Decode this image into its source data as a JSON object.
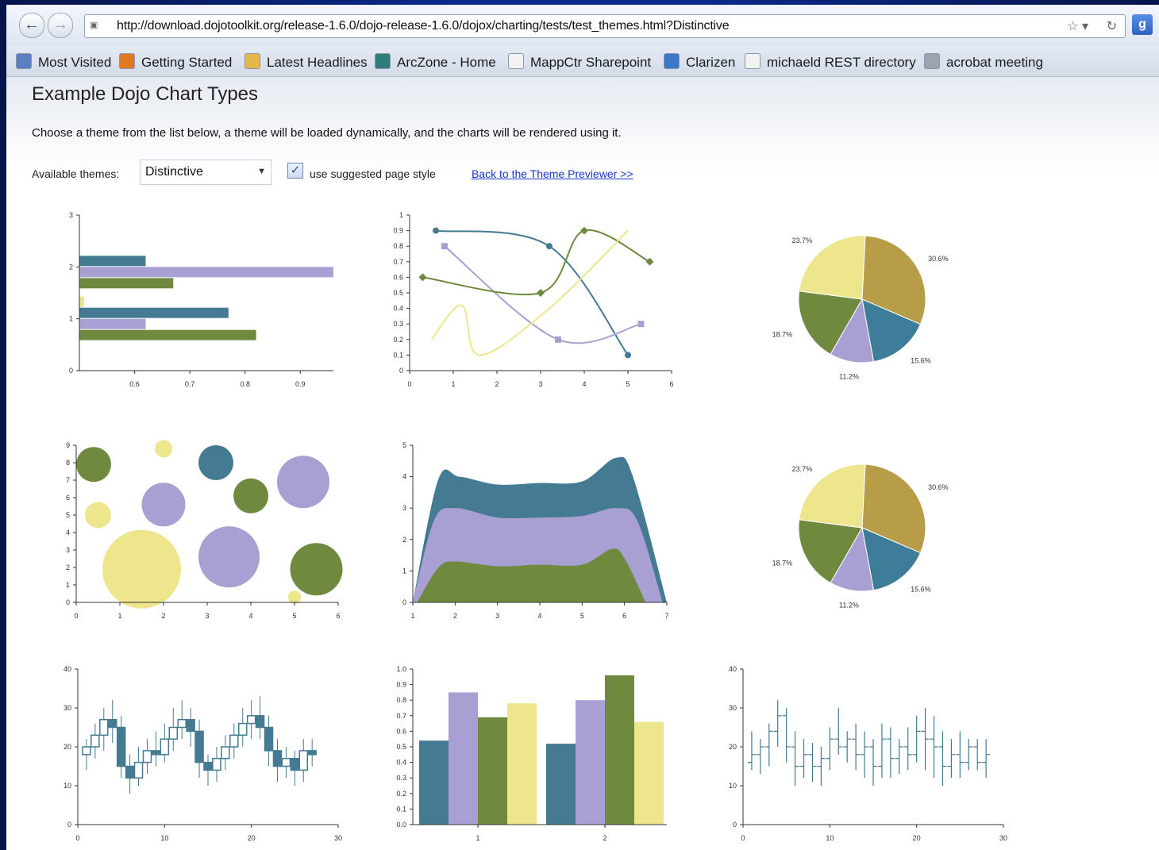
{
  "browser": {
    "url": "http://download.dojotoolkit.org/release-1.6.0/dojo-release-1.6.0/dojox/charting/tests/test_themes.html?Distinctive",
    "bookmarks": [
      "Most Visited",
      "Getting Started",
      "Latest Headlines",
      "ArcZone - Home",
      "MappCtr Sharepoint",
      "Clarizen",
      "michaeld REST directory",
      "acrobat meeting"
    ]
  },
  "page": {
    "title": "Example Dojo Chart Types",
    "intro": "Choose a theme from the list below, a theme will be loaded dynamically, and the charts will be rendered using it.",
    "themes_label": "Available themes:",
    "selected_theme": "Distinctive",
    "checkbox_label": "use suggested page style",
    "link_text": "Back to the Theme Previewer >>"
  },
  "colors": {
    "teal": "#447b93",
    "lavender": "#a8a0d3",
    "olive": "#6f8a3f",
    "yellow": "#ede68d",
    "gold": "#b89d48",
    "blue": "#3d7d99"
  },
  "chart_data": [
    {
      "id": "bars",
      "type": "bar",
      "orientation": "horizontal",
      "categories": [
        "1",
        "2"
      ],
      "series": [
        {
          "values": [
            0.82,
            0.67
          ]
        },
        {
          "values": [
            0.62,
            0.96
          ]
        },
        {
          "values": [
            0.77,
            0.62
          ]
        },
        {
          "values": [
            0.5,
            0
          ]
        }
      ],
      "xlim": [
        0.5,
        0.96
      ],
      "ylim": [
        0,
        3
      ],
      "x_ticks": [
        "0.6",
        "0.7",
        "0.8",
        "0.9"
      ],
      "y_ticks": [
        "0",
        "1",
        "2",
        "3"
      ]
    },
    {
      "id": "lines",
      "type": "line",
      "xlim": [
        0,
        6
      ],
      "ylim": [
        0,
        1
      ],
      "x_ticks": [
        "0",
        "1",
        "2",
        "3",
        "4",
        "5",
        "6"
      ],
      "y_ticks": [
        "0",
        "0.1",
        "0.2",
        "0.3",
        "0.4",
        "0.5",
        "0.6",
        "0.7",
        "0.8",
        "0.9",
        "1"
      ],
      "series": [
        {
          "points": [
            [
              0.6,
              0.9
            ],
            [
              3.2,
              0.8
            ],
            [
              5,
              0.1
            ]
          ],
          "marker": "circle",
          "color": "teal"
        },
        {
          "points": [
            [
              0.8,
              0.8
            ],
            [
              3.4,
              0.2
            ],
            [
              5.3,
              0.3
            ]
          ],
          "marker": "square",
          "color": "lavender"
        },
        {
          "points": [
            [
              0.3,
              0.6
            ],
            [
              3,
              0.5
            ],
            [
              4,
              0.9
            ],
            [
              5.5,
              0.7
            ]
          ],
          "marker": "diamond",
          "color": "olive"
        },
        {
          "points": [
            [
              0.5,
              0.2
            ],
            [
              1.2,
              0.42
            ],
            [
              1.6,
              0.1
            ],
            [
              3.2,
              0.4
            ],
            [
              5,
              0.9
            ]
          ],
          "marker": "none",
          "color": "yellow"
        }
      ]
    },
    {
      "id": "pie1",
      "type": "pie",
      "slices": [
        {
          "label": "30.6%",
          "value": 30.6,
          "color": "gold"
        },
        {
          "label": "15.6%",
          "value": 15.6,
          "color": "blue"
        },
        {
          "label": "11.2%",
          "value": 11.2,
          "color": "lavender"
        },
        {
          "label": "18.7%",
          "value": 18.7,
          "color": "olive"
        },
        {
          "label": "23.7%",
          "value": 23.7,
          "color": "yellow"
        }
      ]
    },
    {
      "id": "bubbles",
      "type": "scatter",
      "subtype": "bubble",
      "xlim": [
        0,
        6
      ],
      "ylim": [
        0,
        9
      ],
      "x_ticks": [
        "0",
        "1",
        "2",
        "3",
        "4",
        "5",
        "6"
      ],
      "y_ticks": [
        "0",
        "1",
        "2",
        "3",
        "4",
        "5",
        "6",
        "7",
        "8",
        "9"
      ],
      "points": [
        {
          "x": 0.4,
          "y": 7.9,
          "r": 0.8,
          "color": "olive"
        },
        {
          "x": 2,
          "y": 8.8,
          "r": 0.4,
          "color": "yellow"
        },
        {
          "x": 3.2,
          "y": 8,
          "r": 0.8,
          "color": "teal"
        },
        {
          "x": 5.2,
          "y": 6.9,
          "r": 1.2,
          "color": "lavender"
        },
        {
          "x": 4,
          "y": 6.1,
          "r": 0.8,
          "color": "olive"
        },
        {
          "x": 2,
          "y": 5.6,
          "r": 1,
          "color": "lavender"
        },
        {
          "x": 0.5,
          "y": 5,
          "r": 0.6,
          "color": "yellow"
        },
        {
          "x": 1.5,
          "y": 1.9,
          "r": 1.8,
          "color": "yellow"
        },
        {
          "x": 3.5,
          "y": 2.6,
          "r": 1.4,
          "color": "lavender"
        },
        {
          "x": 5.5,
          "y": 1.9,
          "r": 1.2,
          "color": "olive"
        },
        {
          "x": 5,
          "y": 0.3,
          "r": 0.3,
          "color": "yellow"
        }
      ]
    },
    {
      "id": "area",
      "type": "area",
      "stacked": true,
      "xlim": [
        1,
        7
      ],
      "ylim": [
        0,
        5
      ],
      "x_ticks": [
        "1",
        "2",
        "3",
        "4",
        "5",
        "6",
        "7"
      ],
      "y_ticks": [
        "0",
        "1",
        "2",
        "3",
        "4",
        "5"
      ],
      "series": [
        {
          "color": "olive",
          "values": [
            [
              1.1,
              0
            ],
            [
              1.6,
              1.1
            ],
            [
              2,
              1.3
            ],
            [
              3,
              1.15
            ],
            [
              4,
              1.2
            ],
            [
              5,
              1.2
            ],
            [
              5.7,
              1.7
            ],
            [
              6,
              1.4
            ],
            [
              6.5,
              0
            ]
          ]
        },
        {
          "color": "lavender",
          "values": [
            [
              1,
              0
            ],
            [
              1.5,
              2.6
            ],
            [
              2,
              3
            ],
            [
              3,
              2.7
            ],
            [
              4,
              2.7
            ],
            [
              5,
              2.75
            ],
            [
              5.8,
              3
            ],
            [
              6.3,
              2.6
            ],
            [
              6.9,
              0
            ]
          ]
        },
        {
          "color": "teal",
          "values": [
            [
              1,
              0
            ],
            [
              1.6,
              3.9
            ],
            [
              2.1,
              4
            ],
            [
              3,
              3.75
            ],
            [
              4,
              3.8
            ],
            [
              5,
              3.85
            ],
            [
              5.8,
              4.6
            ],
            [
              6.2,
              4
            ],
            [
              7,
              0
            ]
          ]
        }
      ]
    },
    {
      "id": "pie2",
      "type": "pie",
      "slices": [
        {
          "label": "30.6%",
          "value": 30.6,
          "color": "gold"
        },
        {
          "label": "15.6%",
          "value": 15.6,
          "color": "blue"
        },
        {
          "label": "11.2%",
          "value": 11.2,
          "color": "lavender"
        },
        {
          "label": "18.7%",
          "value": 18.7,
          "color": "olive"
        },
        {
          "label": "23.7%",
          "value": 23.7,
          "color": "yellow"
        }
      ]
    },
    {
      "id": "candles",
      "type": "candlestick",
      "xlim": [
        0,
        30
      ],
      "ylim": [
        0,
        40
      ],
      "x_ticks": [
        "0",
        "10",
        "20",
        "30"
      ],
      "y_ticks": [
        "0",
        "10",
        "20",
        "30",
        "40"
      ],
      "values": [
        [
          18,
          20,
          14,
          22
        ],
        [
          20,
          23,
          17,
          26
        ],
        [
          23,
          27,
          19,
          30
        ],
        [
          27,
          25,
          21,
          32
        ],
        [
          25,
          15,
          12,
          28
        ],
        [
          15,
          12,
          8,
          18
        ],
        [
          12,
          16,
          10,
          20
        ],
        [
          16,
          19,
          13,
          22
        ],
        [
          19,
          18,
          15,
          24
        ],
        [
          18,
          22,
          16,
          26
        ],
        [
          22,
          25,
          19,
          30
        ],
        [
          25,
          27,
          22,
          32
        ],
        [
          27,
          24,
          20,
          30
        ],
        [
          24,
          16,
          12,
          27
        ],
        [
          16,
          14,
          10,
          18
        ],
        [
          14,
          17,
          11,
          20
        ],
        [
          17,
          20,
          14,
          23
        ],
        [
          20,
          23,
          17,
          26
        ],
        [
          23,
          26,
          20,
          30
        ],
        [
          26,
          28,
          22,
          32
        ],
        [
          28,
          25,
          22,
          33
        ],
        [
          25,
          19,
          15,
          28
        ],
        [
          19,
          15,
          11,
          22
        ],
        [
          15,
          17,
          12,
          20
        ],
        [
          17,
          14,
          10,
          19
        ],
        [
          14,
          19,
          11,
          22
        ],
        [
          19,
          18,
          15,
          22
        ]
      ]
    },
    {
      "id": "columns",
      "type": "bar",
      "categories": [
        "1",
        "2"
      ],
      "ylim": [
        0,
        1
      ],
      "y_ticks": [
        "0.0",
        "0.1",
        "0.2",
        "0.3",
        "0.4",
        "0.5",
        "0.6",
        "0.7",
        "0.8",
        "0.9",
        "1.0"
      ],
      "series": [
        {
          "color": "teal",
          "values": [
            0.54,
            0.52
          ]
        },
        {
          "color": "lavender",
          "values": [
            0.85,
            0.8
          ]
        },
        {
          "color": "olive",
          "values": [
            0.69,
            0.96
          ]
        },
        {
          "color": "yellow",
          "values": [
            0.78,
            0.66
          ]
        }
      ]
    },
    {
      "id": "hilo",
      "type": "ohlc",
      "xlim": [
        0,
        30
      ],
      "ylim": [
        0,
        40
      ],
      "x_ticks": [
        "0",
        "10",
        "20",
        "30"
      ],
      "y_ticks": [
        "0",
        "10",
        "20",
        "30",
        "40"
      ],
      "values": [
        [
          16,
          24,
          18,
          14
        ],
        [
          18,
          22,
          20,
          13
        ],
        [
          20,
          26,
          24,
          15
        ],
        [
          24,
          32,
          28,
          20
        ],
        [
          28,
          30,
          20,
          16
        ],
        [
          20,
          24,
          15,
          10
        ],
        [
          15,
          22,
          18,
          12
        ],
        [
          18,
          21,
          15,
          11
        ],
        [
          15,
          20,
          17,
          10
        ],
        [
          17,
          25,
          22,
          14
        ],
        [
          22,
          30,
          20,
          18
        ],
        [
          20,
          24,
          22,
          16
        ],
        [
          22,
          26,
          18,
          14
        ],
        [
          18,
          24,
          20,
          12
        ],
        [
          20,
          22,
          15,
          10
        ],
        [
          15,
          26,
          22,
          12
        ],
        [
          22,
          25,
          17,
          12
        ],
        [
          17,
          22,
          20,
          13
        ],
        [
          20,
          25,
          18,
          14
        ],
        [
          18,
          28,
          24,
          16
        ],
        [
          24,
          30,
          22,
          14
        ],
        [
          22,
          28,
          20,
          12
        ],
        [
          20,
          24,
          15,
          10
        ],
        [
          15,
          22,
          18,
          12
        ],
        [
          18,
          24,
          16,
          12
        ],
        [
          16,
          22,
          20,
          14
        ],
        [
          20,
          22,
          16,
          14
        ],
        [
          16,
          22,
          18,
          12
        ]
      ]
    }
  ]
}
